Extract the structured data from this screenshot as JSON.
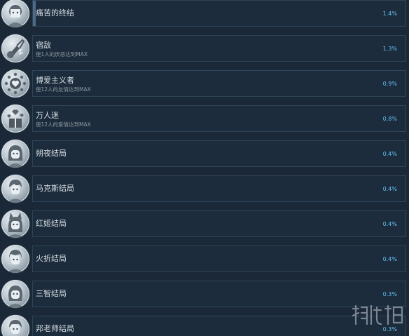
{
  "achievements": [
    {
      "title": "痛苦的终结",
      "desc": "",
      "percent": "1.4%",
      "icon": "girl-portrait-icon"
    },
    {
      "title": "宿敌",
      "desc": "使1人的厌恶达到MAX",
      "percent": "1.3%",
      "icon": "broken-guitar-icon"
    },
    {
      "title": "博爱主义者",
      "desc": "使12人的友情达到MAX",
      "percent": "0.9%",
      "icon": "heart-ring-icon"
    },
    {
      "title": "万人迷",
      "desc": "使12人的爱情达到MAX",
      "percent": "0.8%",
      "icon": "gift-hearts-icon"
    },
    {
      "title": "朔夜结局",
      "desc": "",
      "percent": "0.4%",
      "icon": "girl-portrait-icon"
    },
    {
      "title": "马克斯结局",
      "desc": "",
      "percent": "0.4%",
      "icon": "boy-portrait-icon"
    },
    {
      "title": "红姬结局",
      "desc": "",
      "percent": "0.4%",
      "icon": "fox-girl-portrait-icon"
    },
    {
      "title": "火折结局",
      "desc": "",
      "percent": "0.4%",
      "icon": "boy-portrait-icon"
    },
    {
      "title": "三智结局",
      "desc": "",
      "percent": "0.3%",
      "icon": "girl-portrait-icon"
    },
    {
      "title": "邦老师结局",
      "desc": "",
      "percent": "0.3%",
      "icon": "boy-portrait-icon"
    }
  ],
  "colors": {
    "background": "#1b2838",
    "panel": "#1c2c3c",
    "percent": "#66c0f4"
  }
}
